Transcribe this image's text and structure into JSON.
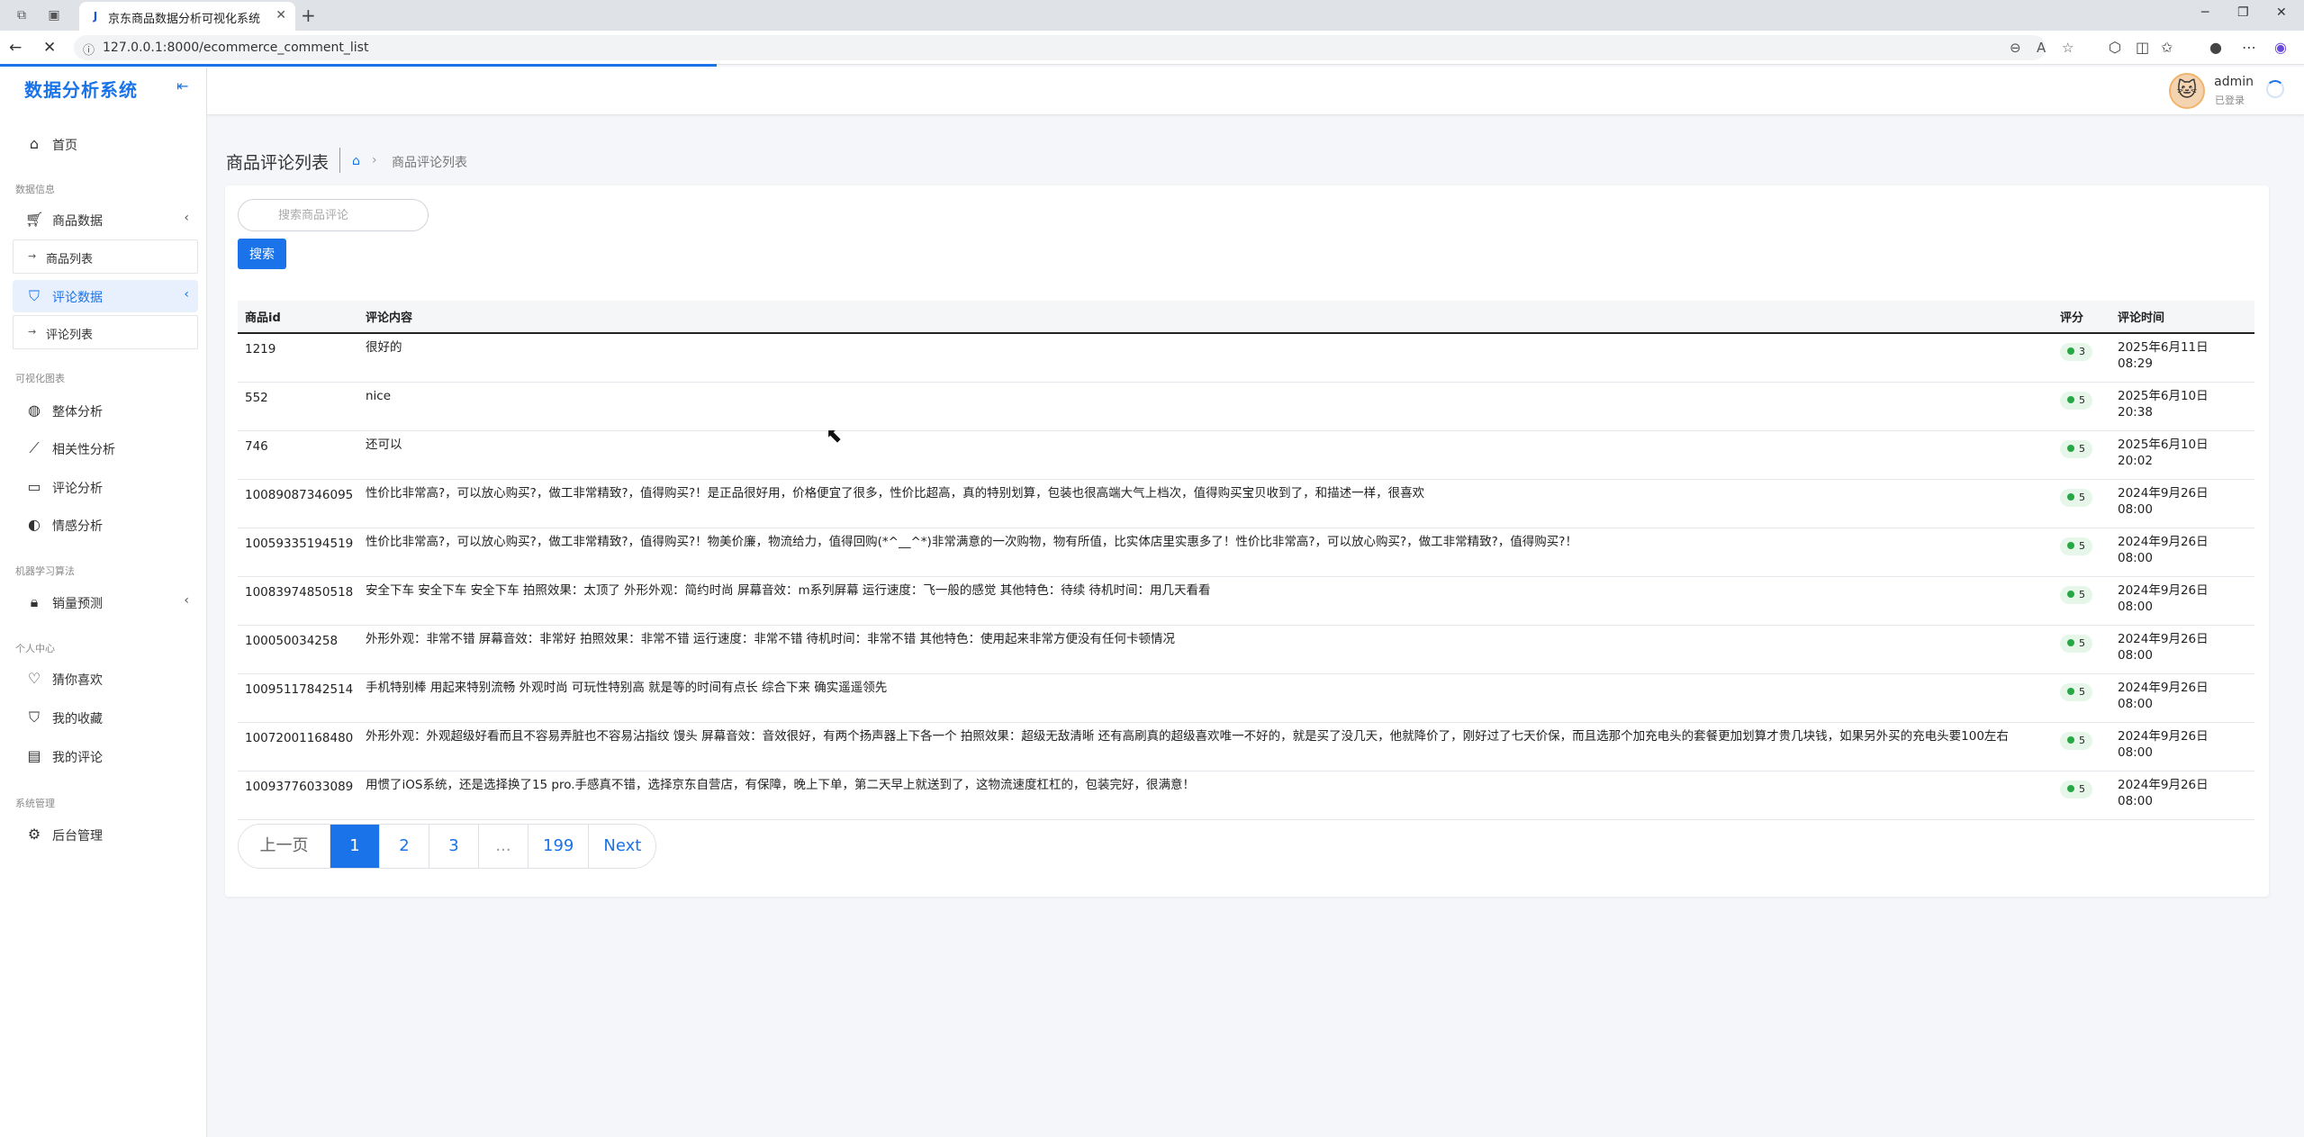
{
  "browser": {
    "tab_title": "京东商品数据分析可视化系统",
    "url": "127.0.0.1:8000/ecommerce_comment_list",
    "tab_favicon": "jd-logo"
  },
  "sidebar": {
    "brand": "数据分析系统",
    "items": [
      {
        "label": "首页",
        "icon": "home-icon"
      },
      {
        "section": "数据信息"
      },
      {
        "label": "商品数据",
        "icon": "cart-icon",
        "expandable": true
      },
      {
        "sub": "商品列表"
      },
      {
        "label": "评论数据",
        "icon": "bookmark-icon",
        "expandable": true,
        "active": true
      },
      {
        "sub": "评论列表"
      },
      {
        "section": "可视化图表"
      },
      {
        "label": "整体分析",
        "icon": "palette-icon"
      },
      {
        "label": "相关性分析",
        "icon": "line-chart-icon"
      },
      {
        "label": "评论分析",
        "icon": "chat-icon"
      },
      {
        "label": "情感分析",
        "icon": "yin-yang-icon"
      },
      {
        "section": "机器学习算法"
      },
      {
        "label": "销量预测",
        "icon": "lock-icon",
        "expandable": true
      },
      {
        "section": "个人中心"
      },
      {
        "label": "猜你喜欢",
        "icon": "heart-icon"
      },
      {
        "label": "我的收藏",
        "icon": "bookmark-icon"
      },
      {
        "label": "我的评论",
        "icon": "comment-icon"
      },
      {
        "section": "系统管理"
      },
      {
        "label": "后台管理",
        "icon": "gear-icon"
      }
    ]
  },
  "header": {
    "user_name": "admin",
    "user_status": "已登录"
  },
  "main": {
    "page_title": "商品评论列表",
    "breadcrumb_current": "商品评论列表",
    "search_placeholder": "搜索商品评论",
    "search_button": "搜索",
    "columns": [
      "商品id",
      "评论内容",
      "评分",
      "评论时间"
    ],
    "rows": [
      {
        "id": "1219",
        "content": "很好的",
        "score": "3",
        "date": "2025年6月11日",
        "time": "08:29"
      },
      {
        "id": "552",
        "content": "nice",
        "score": "5",
        "date": "2025年6月10日",
        "time": "20:38"
      },
      {
        "id": "746",
        "content": "还可以",
        "score": "5",
        "date": "2025年6月10日",
        "time": "20:02"
      },
      {
        "id": "10089087346095",
        "content": "性价比非常高?，可以放心购买?，做工非常精致?，值得购买?！是正品很好用，价格便宜了很多，性价比超高，真的特别划算，包装也很高端大气上档次，值得购买宝贝收到了，和描述一样，很喜欢",
        "score": "5",
        "date": "2024年9月26日",
        "time": "08:00"
      },
      {
        "id": "10059335194519",
        "content": "性价比非常高?，可以放心购买?，做工非常精致?，值得购买?！物美价廉，物流给力，值得回购(*^__^*)非常满意的一次购物，物有所值，比实体店里实惠多了！性价比非常高?，可以放心购买?，做工非常精致?，值得购买?！",
        "score": "5",
        "date": "2024年9月26日",
        "time": "08:00"
      },
      {
        "id": "10083974850518",
        "content": "安全下车 安全下车 安全下车 拍照效果：太顶了 外形外观：简约时尚 屏幕音效：m系列屏幕 运行速度：飞一般的感觉 其他特色：待续 待机时间：用几天看看",
        "score": "5",
        "date": "2024年9月26日",
        "time": "08:00"
      },
      {
        "id": "100050034258",
        "content": "外形外观：非常不错 屏幕音效：非常好 拍照效果：非常不错 运行速度：非常不错 待机时间：非常不错 其他特色：使用起来非常方便没有任何卡顿情况",
        "score": "5",
        "date": "2024年9月26日",
        "time": "08:00"
      },
      {
        "id": "10095117842514",
        "content": "手机特别棒 用起来特别流畅 外观时尚 可玩性特别高 就是等的时间有点长 综合下来 确实遥遥领先",
        "score": "5",
        "date": "2024年9月26日",
        "time": "08:00"
      },
      {
        "id": "10072001168480",
        "content": "外形外观：外观超级好看而且不容易弄脏也不容易沾指纹 馒头 屏幕音效：音效很好，有两个扬声器上下各一个 拍照效果：超级无敌清晰 还有高刷真的超级喜欢唯一不好的，就是买了没几天，他就降价了，刚好过了七天价保，而且选那个加充电头的套餐更加划算才贵几块钱，如果另外买的充电头要100左右",
        "score": "5",
        "date": "2024年9月26日",
        "time": "08:00"
      },
      {
        "id": "10093776033089",
        "content": "用惯了iOS系统，还是选择换了15 pro.手感真不错，选择京东自营店，有保障，晚上下单，第二天早上就送到了，这物流速度杠杠的，包装完好，很满意！",
        "score": "5",
        "date": "2024年9月26日",
        "time": "08:00"
      }
    ],
    "pagination": [
      "上一页",
      "1",
      "2",
      "3",
      "...",
      "199",
      "Next"
    ],
    "current_page": "1"
  },
  "colors": {
    "accent": "#1a73e8",
    "badge_bg": "#e6f7ea",
    "badge_dot": "#28a745"
  }
}
